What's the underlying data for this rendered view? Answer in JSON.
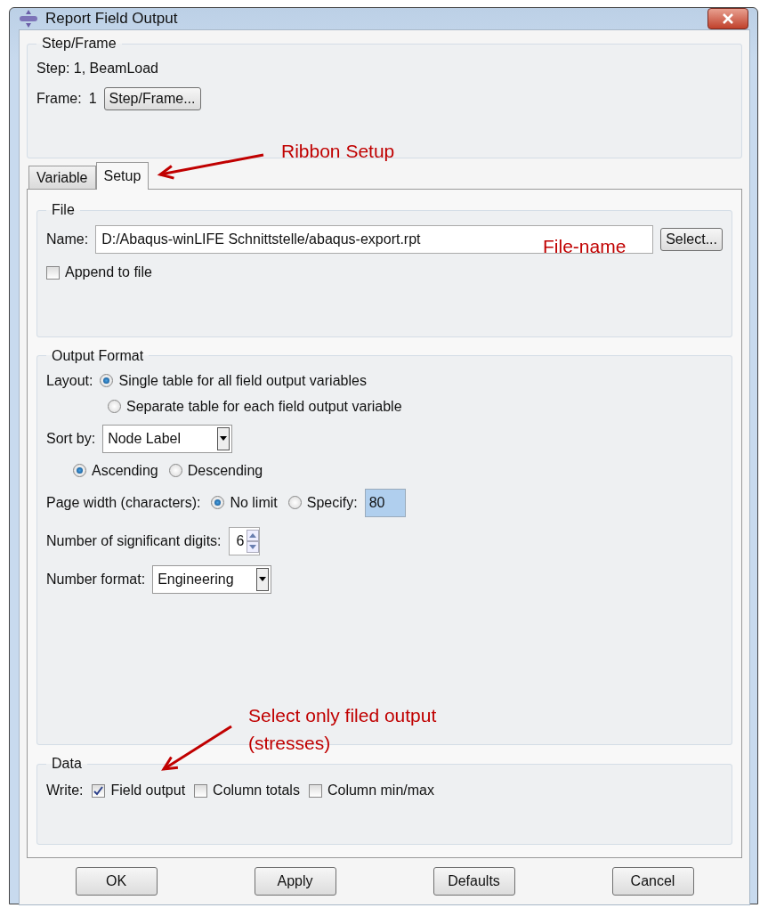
{
  "window": {
    "title": "Report Field Output"
  },
  "step_frame": {
    "title": "Step/Frame",
    "step_text": "Step: 1, BeamLoad",
    "frame_label": "Frame:",
    "frame_value": "1",
    "button": "Step/Frame..."
  },
  "tabs": [
    {
      "label": "Variable",
      "selected": false
    },
    {
      "label": "Setup",
      "selected": true
    }
  ],
  "file": {
    "title": "File",
    "name_label": "Name:",
    "name_value": "D:/Abaqus-winLIFE Schnittstelle/abaqus-export.rpt",
    "select_button": "Select...",
    "append": {
      "label": "Append to file",
      "checked": false
    }
  },
  "output_format": {
    "title": "Output Format",
    "layout_label": "Layout:",
    "layout_options": [
      {
        "label": "Single table for all field output variables",
        "selected": true
      },
      {
        "label": "Separate table for each field output variable",
        "selected": false
      }
    ],
    "sort_by": {
      "label": "Sort by:",
      "value": "Node Label"
    },
    "order_options": [
      {
        "label": "Ascending",
        "selected": true
      },
      {
        "label": "Descending",
        "selected": false
      }
    ],
    "page_width": {
      "label": "Page width (characters):",
      "options": [
        {
          "label": "No limit",
          "selected": true
        },
        {
          "label": "Specify:",
          "selected": false
        }
      ],
      "specify_value": "80"
    },
    "significant_digits": {
      "label": "Number of significant digits:",
      "value": "6"
    },
    "number_format": {
      "label": "Number format:",
      "value": "Engineering"
    }
  },
  "data": {
    "title": "Data",
    "write_label": "Write:",
    "options": [
      {
        "label": "Field output",
        "checked": true
      },
      {
        "label": "Column totals",
        "checked": false
      },
      {
        "label": "Column min/max",
        "checked": false
      }
    ]
  },
  "buttons": [
    "OK",
    "Apply",
    "Defaults",
    "Cancel"
  ],
  "annotations": [
    {
      "text": "Ribbon Setup"
    },
    {
      "text": "File-name"
    },
    {
      "text": "Select only filed output (stresses)"
    }
  ]
}
